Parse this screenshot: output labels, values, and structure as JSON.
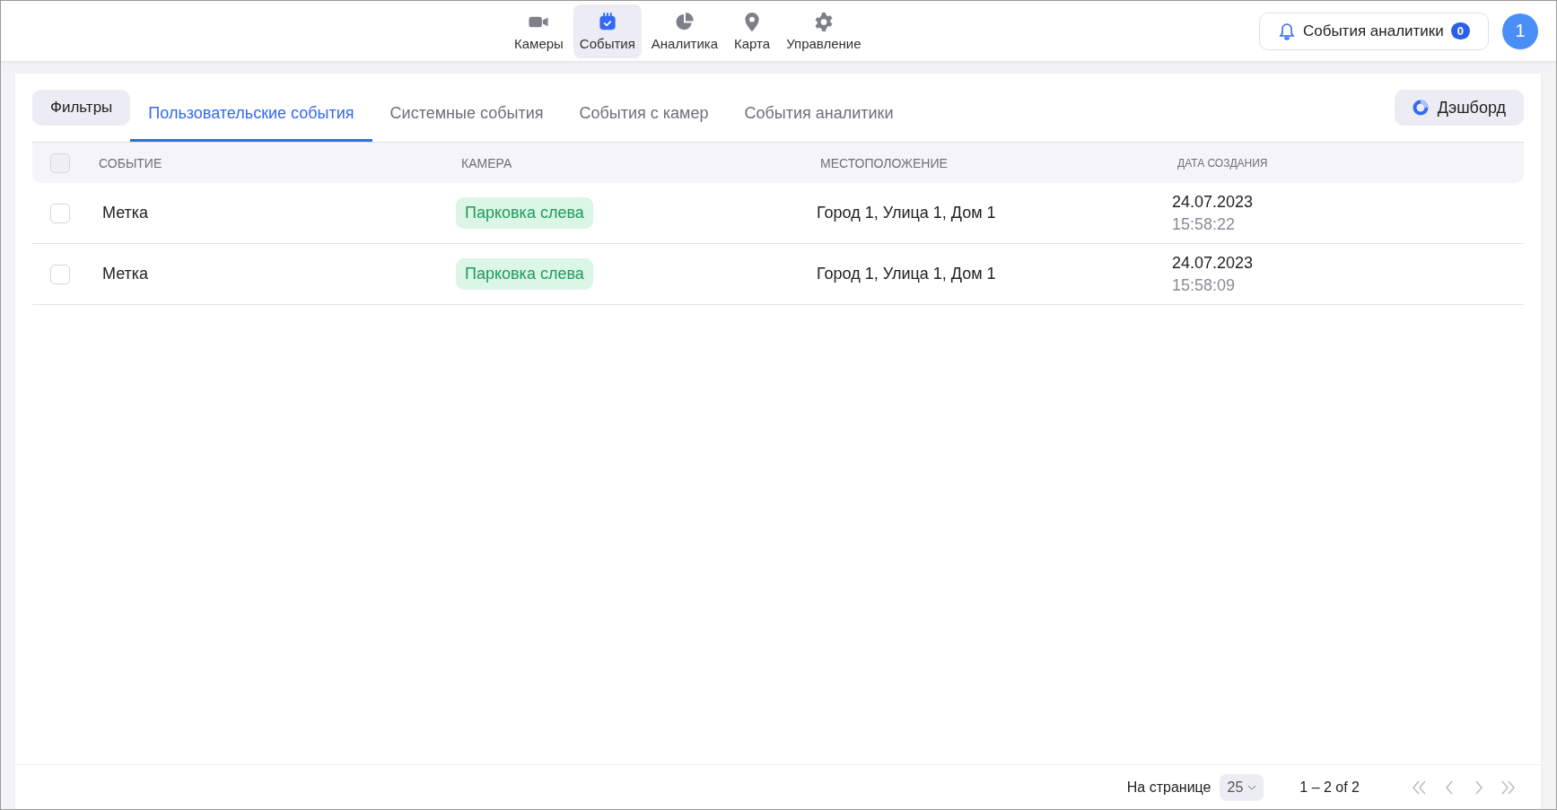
{
  "nav": [
    {
      "kind": "camera",
      "label": "Камеры",
      "selected": false
    },
    {
      "kind": "events",
      "label": "События",
      "selected": true
    },
    {
      "kind": "analytics",
      "label": "Аналитика",
      "selected": false
    },
    {
      "kind": "map",
      "label": "Карта",
      "selected": false
    },
    {
      "kind": "settings",
      "label": "Управление",
      "selected": false
    }
  ],
  "notifications": {
    "label": "События аналитики",
    "count": "0"
  },
  "avatar": "1",
  "filters_button": "Фильтры",
  "tabs": [
    {
      "label": "Пользовательские события",
      "selected": true
    },
    {
      "label": "Системные события",
      "selected": false
    },
    {
      "label": "События с камер",
      "selected": false
    },
    {
      "label": "События аналитики",
      "selected": false
    }
  ],
  "dashboard_button": "Дэшборд",
  "table": {
    "select_all_checked": false,
    "columns": [
      "СОБЫТИЕ",
      "КАМЕРА",
      "МЕСТОПОЛОЖЕНИЕ",
      "ДАТА СОЗДАНИЯ"
    ],
    "rows": [
      {
        "checked": false,
        "event": "Метка",
        "camera": "Парковка слева",
        "location": "Город 1, Улица 1, Дом 1",
        "date": "24.07.2023",
        "time": "15:58:22"
      },
      {
        "checked": false,
        "event": "Метка",
        "camera": "Парковка слева",
        "location": "Город 1, Улица 1, Дом 1",
        "date": "24.07.2023",
        "time": "15:58:09"
      }
    ]
  },
  "pagination": {
    "per_page_label": "На странице",
    "per_page": "25",
    "range": "1 – 2 of 2",
    "buttons": [
      {
        "kind": "first",
        "disabled": true
      },
      {
        "kind": "prev",
        "disabled": true
      },
      {
        "kind": "next",
        "disabled": true
      },
      {
        "kind": "last",
        "disabled": true
      }
    ]
  }
}
